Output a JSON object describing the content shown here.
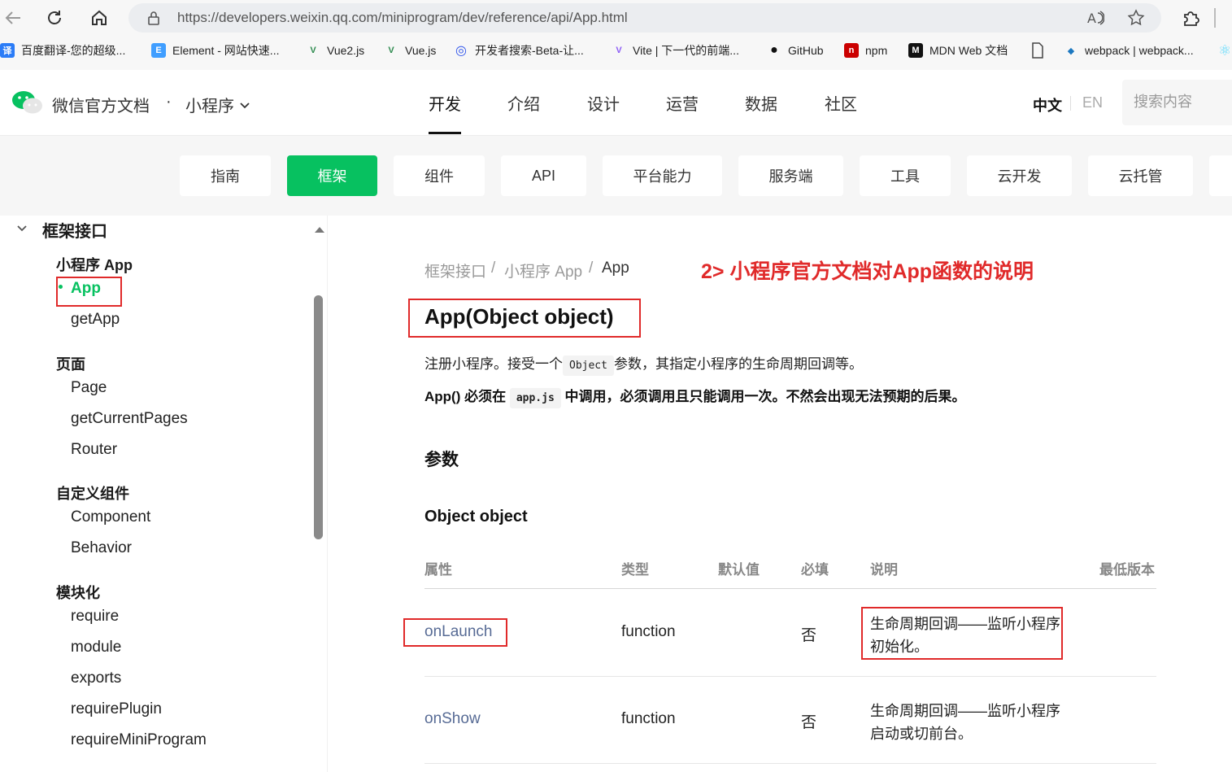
{
  "browser": {
    "url": "https://developers.weixin.qq.com/miniprogram/dev/reference/api/App.html",
    "bookmarks": [
      {
        "icon": "译",
        "label": "百度翻译-您的超级..."
      },
      {
        "icon": "E",
        "label": "Element - 网站快速..."
      },
      {
        "icon": "V",
        "label": "Vue2.js"
      },
      {
        "icon": "V",
        "label": "Vue.js"
      },
      {
        "icon": "◎",
        "label": "开发者搜索-Beta-让..."
      },
      {
        "icon": "V",
        "label": "Vite | 下一代的前端..."
      },
      {
        "icon": "●",
        "label": "GitHub"
      },
      {
        "icon": "n",
        "label": "npm"
      },
      {
        "icon": "M",
        "label": "MDN Web 文档"
      },
      {
        "icon": "",
        "label": ""
      },
      {
        "icon": "◆",
        "label": "webpack | webpack..."
      }
    ]
  },
  "header": {
    "logo_text": "微信官方文档",
    "separator": "·",
    "product": "小程序",
    "nav": [
      "开发",
      "介绍",
      "设计",
      "运营",
      "数据",
      "社区"
    ],
    "active_nav": "开发",
    "lang_zh": "中文",
    "lang_en": "EN",
    "search_placeholder": "搜索内容"
  },
  "categories": [
    "指南",
    "框架",
    "组件",
    "API",
    "平台能力",
    "服务端",
    "工具",
    "云开发",
    "云托管"
  ],
  "active_category": "框架",
  "sidebar": {
    "section_title": "框架接口",
    "groups": [
      {
        "title": "小程序 App",
        "items": [
          "App",
          "getApp"
        ]
      },
      {
        "title": "页面",
        "items": [
          "Page",
          "getCurrentPages",
          "Router"
        ]
      },
      {
        "title": "自定义组件",
        "items": [
          "Component",
          "Behavior"
        ]
      },
      {
        "title": "模块化",
        "items": [
          "require",
          "module",
          "exports",
          "requirePlugin",
          "requireMiniProgram"
        ]
      }
    ],
    "active_item": "App"
  },
  "main": {
    "breadcrumb": [
      "框架接口",
      "/",
      "小程序 App",
      "/",
      "App"
    ],
    "annotation": "2> 小程序官方文档对App函数的说明",
    "title": "App(Object object)",
    "desc_pre": "注册小程序。接受一个",
    "desc_code": "Object",
    "desc_post": "参数，其指定小程序的生命周期回调等。",
    "warn_pre": "App() 必须在",
    "warn_code": "app.js",
    "warn_post": "中调用，必须调用且只能调用一次。不然会出现无法预期的后果。",
    "params_heading": "参数",
    "object_heading": "Object object",
    "table": {
      "headers": [
        "属性",
        "类型",
        "默认值",
        "必填",
        "说明",
        "最低版本"
      ],
      "rows": [
        {
          "name": "onLaunch",
          "type": "function",
          "default": "",
          "required": "否",
          "desc_line1": "生命周期回调——监听小程序",
          "desc_line2": "初始化。",
          "min_version": ""
        },
        {
          "name": "onShow",
          "type": "function",
          "default": "",
          "required": "否",
          "desc_line1": "生命周期回调——监听小程序",
          "desc_line2": "启动或切前台。",
          "min_version": ""
        }
      ]
    }
  },
  "colors": {
    "brand_green": "#07c160",
    "link_blue": "#576b95",
    "annotation_red": "#e02a2a"
  }
}
